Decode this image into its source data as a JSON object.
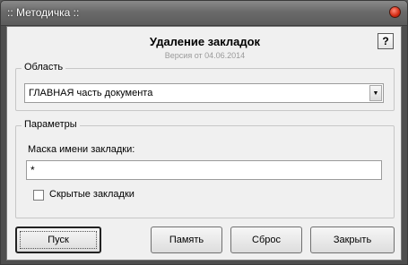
{
  "window": {
    "title": ":: Методичка ::"
  },
  "dialog": {
    "title": "Удаление закладок",
    "version": "Версия от  04.06.2014",
    "help_label": "?"
  },
  "area_group": {
    "legend": "Область",
    "selected": "ГЛАВНАЯ часть документа",
    "arrow": "▼"
  },
  "params_group": {
    "legend": "Параметры",
    "mask_label": "Маска имени закладки:",
    "mask_value": "*",
    "hidden_checkbox_label": "Скрытые закладки",
    "hidden_checked": false
  },
  "buttons": {
    "run": "Пуск",
    "memory": "Память",
    "reset": "Сброс",
    "close": "Закрыть"
  },
  "colors": {
    "titlebar": "#6a6a6a",
    "client_bg": "#f0f0f0",
    "close_btn": "#d42a12"
  },
  "icons": {
    "close": "close-circle-icon",
    "dropdown": "chevron-down-icon"
  }
}
